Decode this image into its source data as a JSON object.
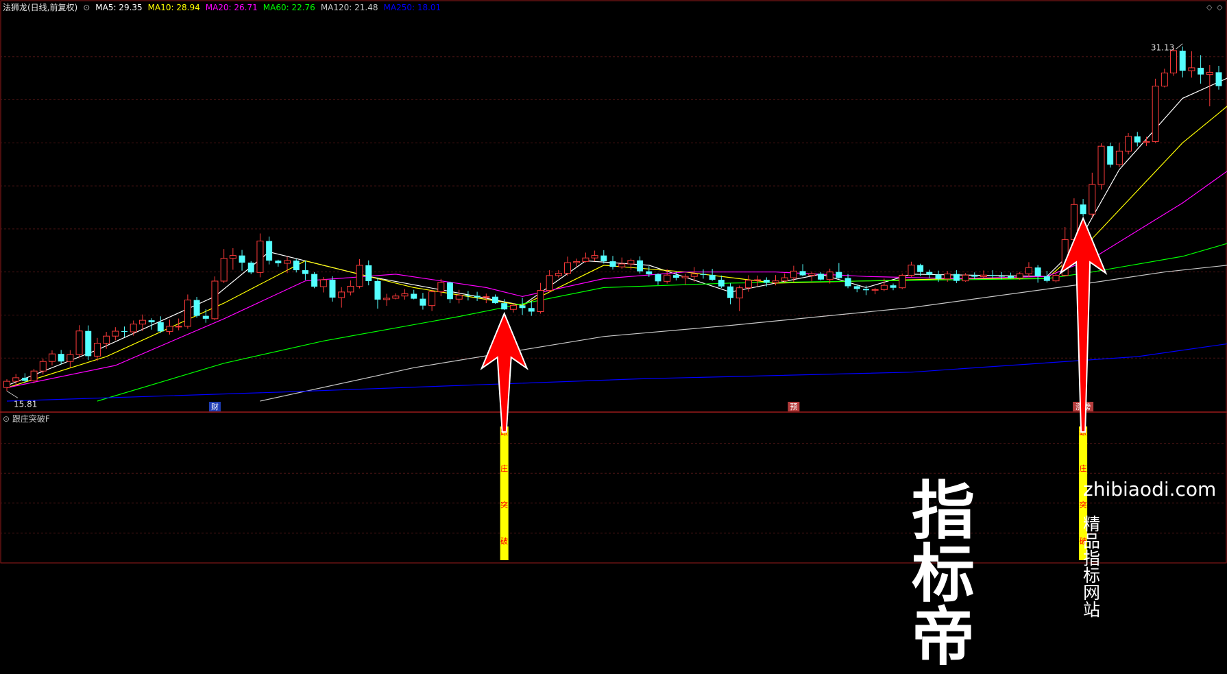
{
  "header": {
    "title": "法狮龙(日线,前复权)",
    "indicators": [
      {
        "label": "MA5: 29.35",
        "color": "#ffffff"
      },
      {
        "label": "MA10: 28.94",
        "color": "#ffff00"
      },
      {
        "label": "MA20: 26.71",
        "color": "#ff00ff"
      },
      {
        "label": "MA60: 22.76",
        "color": "#00ff00"
      },
      {
        "label": "MA120: 21.48",
        "color": "#c8c8c8"
      },
      {
        "label": "MA250: 18.01",
        "color": "#0000ff"
      }
    ]
  },
  "sub_panel": {
    "title": "跟庄突破F"
  },
  "watermark": {
    "logo": "指标帝",
    "site": "zhibiaodi.com",
    "slogan": "精品指标网站"
  },
  "chart_data": {
    "type": "candlestick",
    "y_min_label": "15.81",
    "y_max_label": "31.13",
    "ylim": [
      15.2,
      32.6
    ],
    "grid": true,
    "colors": {
      "up": "#ff3b3b",
      "down": "#54ffff",
      "signal": "#ffff00",
      "arrow": "#ff0000",
      "panel_border": "#9c1c1c"
    },
    "candles": [
      [
        15.81,
        16.18,
        15.65,
        16.09
      ],
      [
        16.09,
        16.42,
        15.9,
        16.25
      ],
      [
        16.25,
        16.45,
        16.02,
        16.11
      ],
      [
        16.11,
        16.65,
        16.0,
        16.55
      ],
      [
        16.55,
        17.11,
        16.4,
        16.98
      ],
      [
        16.98,
        17.48,
        16.8,
        17.32
      ],
      [
        17.32,
        17.5,
        16.85,
        16.98
      ],
      [
        16.98,
        17.49,
        16.72,
        17.29
      ],
      [
        17.29,
        18.61,
        17.15,
        18.35
      ],
      [
        18.35,
        18.6,
        17.05,
        17.22
      ],
      [
        17.22,
        18.04,
        17.0,
        17.8
      ],
      [
        17.8,
        18.31,
        17.55,
        18.12
      ],
      [
        18.12,
        18.52,
        17.93,
        18.34
      ],
      [
        18.34,
        18.55,
        18.08,
        18.31
      ],
      [
        18.31,
        18.82,
        18.14,
        18.66
      ],
      [
        18.66,
        19.09,
        18.34,
        18.83
      ],
      [
        18.83,
        18.92,
        18.41,
        18.74
      ],
      [
        18.74,
        19.01,
        18.27,
        18.33
      ],
      [
        18.33,
        18.86,
        18.19,
        18.56
      ],
      [
        18.56,
        18.91,
        18.38,
        18.56
      ],
      [
        18.56,
        19.99,
        18.45,
        19.74
      ],
      [
        19.74,
        19.88,
        18.95,
        19.03
      ],
      [
        19.03,
        19.33,
        18.72,
        18.9
      ],
      [
        18.9,
        20.8,
        18.83,
        20.59
      ],
      [
        20.59,
        22.03,
        20.5,
        21.61
      ],
      [
        21.61,
        22.07,
        21.1,
        21.74
      ],
      [
        21.74,
        21.99,
        21.06,
        21.42
      ],
      [
        21.42,
        21.49,
        20.9,
        20.98
      ],
      [
        20.98,
        22.73,
        20.76,
        22.39
      ],
      [
        22.39,
        22.59,
        21.34,
        21.51
      ],
      [
        21.51,
        21.55,
        21.24,
        21.39
      ],
      [
        21.39,
        21.69,
        20.95,
        21.51
      ],
      [
        21.51,
        21.59,
        20.98,
        21.08
      ],
      [
        21.08,
        21.51,
        20.64,
        20.91
      ],
      [
        20.91,
        20.99,
        20.27,
        20.34
      ],
      [
        20.34,
        20.77,
        20.08,
        20.65
      ],
      [
        20.65,
        20.81,
        19.67,
        19.85
      ],
      [
        19.85,
        20.32,
        19.4,
        20.1
      ],
      [
        20.1,
        20.62,
        19.95,
        20.36
      ],
      [
        20.36,
        21.58,
        20.26,
        21.3
      ],
      [
        21.3,
        21.52,
        20.4,
        20.59
      ],
      [
        20.59,
        20.75,
        19.35,
        19.76
      ],
      [
        19.76,
        20.02,
        19.48,
        19.82
      ],
      [
        19.82,
        20.04,
        19.77,
        19.92
      ],
      [
        19.92,
        20.23,
        19.76,
        20.02
      ],
      [
        20.02,
        20.2,
        19.77,
        19.8
      ],
      [
        19.8,
        20.06,
        19.31,
        19.49
      ],
      [
        19.49,
        20.2,
        19.25,
        20.11
      ],
      [
        20.11,
        20.69,
        19.91,
        20.53
      ],
      [
        20.53,
        20.57,
        19.6,
        19.78
      ],
      [
        19.78,
        20.2,
        19.59,
        19.96
      ],
      [
        19.96,
        20.15,
        19.72,
        19.93
      ],
      [
        19.93,
        20.11,
        19.7,
        19.86
      ],
      [
        19.86,
        20.03,
        19.6,
        19.89
      ],
      [
        19.89,
        19.99,
        19.57,
        19.6
      ],
      [
        19.6,
        19.78,
        19.29,
        19.32
      ],
      [
        19.32,
        19.59,
        19.18,
        19.5
      ],
      [
        19.5,
        19.84,
        19.07,
        19.38
      ],
      [
        19.38,
        19.71,
        19.03,
        19.22
      ],
      [
        19.22,
        20.51,
        19.13,
        20.17
      ],
      [
        20.17,
        21.08,
        20.08,
        20.84
      ],
      [
        20.84,
        21.08,
        20.75,
        20.94
      ],
      [
        20.94,
        21.69,
        20.83,
        21.42
      ],
      [
        21.42,
        21.6,
        21.22,
        21.47
      ],
      [
        21.47,
        21.87,
        21.42,
        21.63
      ],
      [
        21.63,
        21.96,
        21.48,
        21.74
      ],
      [
        21.74,
        21.98,
        21.38,
        21.48
      ],
      [
        21.48,
        21.72,
        21.11,
        21.23
      ],
      [
        21.23,
        21.65,
        21.15,
        21.36
      ],
      [
        21.36,
        21.6,
        21.1,
        21.52
      ],
      [
        21.52,
        21.7,
        20.93,
        21.03
      ],
      [
        21.03,
        21.26,
        20.78,
        20.9
      ],
      [
        20.9,
        20.94,
        20.42,
        20.58
      ],
      [
        20.58,
        21.13,
        20.48,
        20.86
      ],
      [
        20.86,
        21.0,
        20.62,
        20.74
      ],
      [
        20.74,
        20.92,
        20.44,
        20.8
      ],
      [
        20.8,
        21.22,
        20.56,
        20.91
      ],
      [
        20.91,
        21.12,
        20.7,
        20.87
      ],
      [
        20.87,
        21.14,
        20.6,
        20.65
      ],
      [
        20.65,
        20.84,
        20.28,
        20.35
      ],
      [
        20.35,
        20.49,
        19.55,
        19.83
      ],
      [
        19.83,
        20.39,
        19.24,
        20.29
      ],
      [
        20.29,
        20.85,
        20.11,
        20.63
      ],
      [
        20.63,
        20.84,
        20.36,
        20.65
      ],
      [
        20.65,
        20.76,
        20.35,
        20.52
      ],
      [
        20.52,
        20.86,
        20.4,
        20.6
      ],
      [
        20.6,
        20.94,
        20.53,
        20.74
      ],
      [
        20.74,
        21.28,
        20.55,
        21.04
      ],
      [
        21.04,
        21.35,
        20.81,
        20.85
      ],
      [
        20.85,
        21.01,
        20.58,
        20.92
      ],
      [
        20.92,
        20.99,
        20.62,
        20.66
      ],
      [
        20.66,
        21.15,
        20.48,
        21.0
      ],
      [
        21.0,
        21.4,
        20.69,
        20.73
      ],
      [
        20.73,
        20.91,
        20.27,
        20.36
      ],
      [
        20.36,
        20.44,
        20.09,
        20.24
      ],
      [
        20.24,
        20.39,
        19.96,
        20.18
      ],
      [
        20.18,
        20.29,
        20.0,
        20.21
      ],
      [
        20.21,
        20.7,
        20.14,
        20.4
      ],
      [
        20.4,
        20.48,
        20.18,
        20.29
      ],
      [
        20.29,
        20.93,
        20.23,
        20.85
      ],
      [
        20.85,
        21.46,
        20.78,
        21.31
      ],
      [
        21.31,
        21.37,
        20.82,
        21.0
      ],
      [
        21.0,
        21.1,
        20.72,
        20.88
      ],
      [
        20.88,
        21.06,
        20.55,
        20.69
      ],
      [
        20.69,
        21.04,
        20.56,
        20.91
      ],
      [
        20.91,
        21.08,
        20.5,
        20.6
      ],
      [
        20.6,
        20.95,
        20.56,
        20.86
      ],
      [
        20.86,
        20.98,
        20.68,
        20.79
      ],
      [
        20.79,
        21.07,
        20.73,
        20.86
      ],
      [
        20.86,
        21.08,
        20.72,
        20.82
      ],
      [
        20.82,
        20.99,
        20.67,
        20.81
      ],
      [
        20.81,
        20.97,
        20.7,
        20.73
      ],
      [
        20.73,
        21.0,
        20.65,
        20.92
      ],
      [
        20.92,
        21.44,
        20.78,
        21.2
      ],
      [
        21.2,
        21.31,
        20.52,
        20.81
      ],
      [
        20.81,
        21.05,
        20.53,
        20.6
      ],
      [
        20.6,
        21.04,
        20.53,
        20.85
      ],
      [
        20.85,
        23.02,
        20.8,
        22.45
      ],
      [
        22.45,
        24.31,
        22.3,
        24.03
      ],
      [
        24.03,
        24.28,
        23.5,
        23.6
      ],
      [
        23.6,
        25.46,
        23.44,
        24.93
      ],
      [
        24.93,
        26.78,
        24.7,
        26.65
      ],
      [
        26.65,
        26.81,
        25.69,
        25.82
      ],
      [
        25.82,
        26.81,
        25.7,
        26.43
      ],
      [
        26.43,
        27.24,
        26.28,
        27.09
      ],
      [
        27.09,
        27.29,
        26.64,
        26.82
      ],
      [
        26.82,
        27.07,
        26.66,
        26.86
      ],
      [
        26.86,
        29.68,
        26.79,
        29.35
      ],
      [
        29.35,
        30.13,
        29.29,
        29.94
      ],
      [
        29.94,
        31.07,
        29.81,
        30.94
      ],
      [
        30.94,
        31.13,
        29.74,
        30.04
      ],
      [
        30.04,
        30.92,
        29.73,
        30.17
      ],
      [
        30.17,
        30.74,
        29.46,
        29.87
      ],
      [
        29.87,
        30.29,
        28.44,
        29.97
      ],
      [
        29.97,
        30.26,
        29.19,
        29.35
      ]
    ],
    "moving_averages": [
      {
        "name": "MA5",
        "color": "#ffffff",
        "values": [
          [
            0,
            15.9
          ],
          [
            10,
            17.5
          ],
          [
            23,
            19.9
          ],
          [
            29,
            21.9
          ],
          [
            40,
            20.8
          ],
          [
            52,
            19.9
          ],
          [
            57,
            19.5
          ],
          [
            64,
            21.5
          ],
          [
            71,
            21.3
          ],
          [
            80,
            20.1
          ],
          [
            90,
            20.9
          ],
          [
            95,
            20.3
          ],
          [
            100,
            20.9
          ],
          [
            115,
            20.8
          ],
          [
            118,
            22.0
          ],
          [
            123,
            25.6
          ],
          [
            130,
            28.8
          ],
          [
            136,
            29.9
          ],
          [
            139,
            29.35
          ]
        ]
      },
      {
        "name": "MA10",
        "color": "#ffff00",
        "values": [
          [
            0,
            15.8
          ],
          [
            11,
            17.2
          ],
          [
            24,
            19.6
          ],
          [
            33,
            21.5
          ],
          [
            45,
            20.3
          ],
          [
            57,
            19.5
          ],
          [
            66,
            21.3
          ],
          [
            75,
            21.0
          ],
          [
            85,
            20.5
          ],
          [
            95,
            20.6
          ],
          [
            105,
            20.7
          ],
          [
            115,
            20.7
          ],
          [
            120,
            22.5
          ],
          [
            130,
            26.8
          ],
          [
            136,
            28.8
          ],
          [
            139,
            28.94
          ]
        ]
      },
      {
        "name": "MA20",
        "color": "#ff00ff",
        "values": [
          [
            0,
            15.8
          ],
          [
            12,
            16.8
          ],
          [
            24,
            18.9
          ],
          [
            33,
            20.6
          ],
          [
            43,
            20.9
          ],
          [
            53,
            20.3
          ],
          [
            57,
            19.9
          ],
          [
            66,
            20.7
          ],
          [
            75,
            21.0
          ],
          [
            85,
            21.0
          ],
          [
            95,
            20.8
          ],
          [
            105,
            20.7
          ],
          [
            115,
            20.8
          ],
          [
            120,
            21.6
          ],
          [
            130,
            24.1
          ],
          [
            139,
            26.71
          ]
        ]
      },
      {
        "name": "MA60",
        "color": "#00ff00",
        "values": [
          [
            10,
            15.2
          ],
          [
            24,
            16.9
          ],
          [
            35,
            17.9
          ],
          [
            50,
            19.0
          ],
          [
            66,
            20.3
          ],
          [
            80,
            20.5
          ],
          [
            95,
            20.6
          ],
          [
            115,
            20.7
          ],
          [
            120,
            21.0
          ],
          [
            130,
            21.7
          ],
          [
            139,
            22.76
          ]
        ]
      },
      {
        "name": "MA120",
        "color": "#c8c8c8",
        "values": [
          [
            28,
            15.2
          ],
          [
            45,
            16.7
          ],
          [
            66,
            18.1
          ],
          [
            80,
            18.6
          ],
          [
            100,
            19.4
          ],
          [
            118,
            20.4
          ],
          [
            128,
            21.0
          ],
          [
            139,
            21.48
          ]
        ]
      },
      {
        "name": "MA250",
        "color": "#0000ff",
        "values": [
          [
            0,
            15.2
          ],
          [
            30,
            15.6
          ],
          [
            70,
            16.2
          ],
          [
            100,
            16.5
          ],
          [
            125,
            17.2
          ],
          [
            139,
            18.01
          ]
        ]
      }
    ],
    "event_labels": [
      {
        "index": 23,
        "text": "财",
        "bg": "#1e3cb4"
      },
      {
        "index": 87,
        "text": "预",
        "bg": "#b43c3c"
      },
      {
        "index": 119,
        "text": "涨榜",
        "bg": "#b43c3c"
      }
    ],
    "signals": [
      {
        "index": 55,
        "text": [
          "跟",
          "庄",
          "突",
          "破"
        ]
      },
      {
        "index": 119,
        "text": [
          "跟",
          "庄",
          "突",
          "破"
        ]
      }
    ]
  }
}
